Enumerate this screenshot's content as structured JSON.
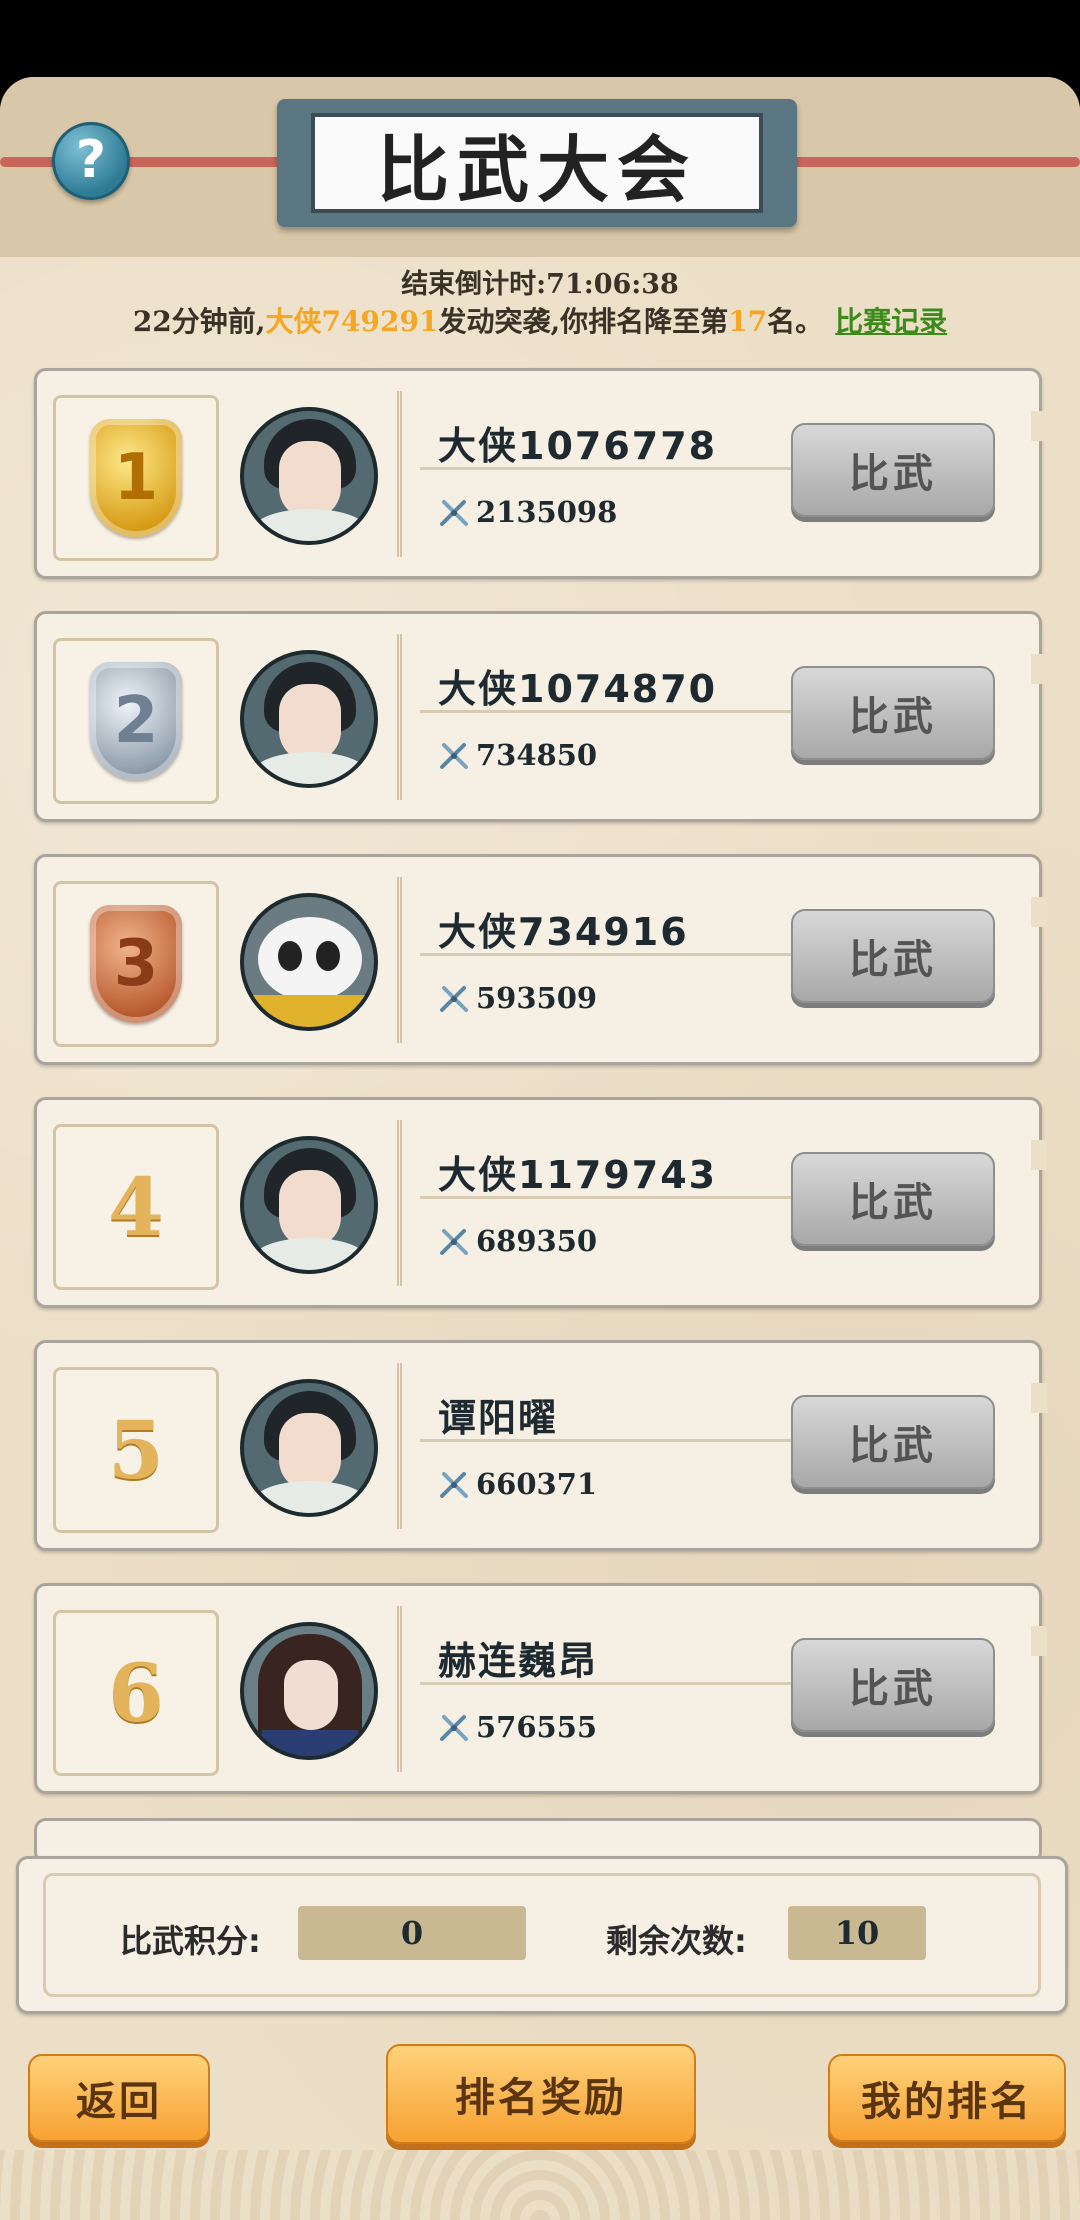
{
  "header": {
    "title": "比武大会",
    "help_icon_glyph": "?"
  },
  "countdown": {
    "label": "结束倒计时:",
    "value": "71:06:38"
  },
  "news": {
    "prefix": "22分钟前,",
    "attacker": "大侠749291",
    "middle": "发动突袭,你排名降至第",
    "rank": "17",
    "suffix": "名。",
    "record_link": "比赛记录"
  },
  "ranking": [
    {
      "rank": "1",
      "medal": "gold",
      "name": "大侠1076778",
      "power": "2135098",
      "avatar": "man",
      "button": "比武"
    },
    {
      "rank": "2",
      "medal": "silver",
      "name": "大侠1074870",
      "power": "734850",
      "avatar": "man",
      "button": "比武"
    },
    {
      "rank": "3",
      "medal": "bronze",
      "name": "大侠734916",
      "power": "593509",
      "avatar": "panda",
      "button": "比武"
    },
    {
      "rank": "4",
      "medal": "",
      "name": "大侠1179743",
      "power": "689350",
      "avatar": "man",
      "button": "比武"
    },
    {
      "rank": "5",
      "medal": "",
      "name": "谭阳曜",
      "power": "660371",
      "avatar": "man",
      "button": "比武"
    },
    {
      "rank": "6",
      "medal": "",
      "name": "赫连巍昂",
      "power": "576555",
      "avatar": "woman",
      "button": "比武"
    }
  ],
  "score": {
    "points_label": "比武积分:",
    "points_value": "0",
    "remaining_label": "剩余次数:",
    "remaining_value": "10"
  },
  "bottom": {
    "back": "返回",
    "rewards": "排名奖励",
    "my_rank": "我的排名"
  },
  "colors": {
    "highlight": "#f5a623",
    "link": "#3c8a1a",
    "button_orange": "#f7a133",
    "button_grey": "#a8a8a8"
  }
}
